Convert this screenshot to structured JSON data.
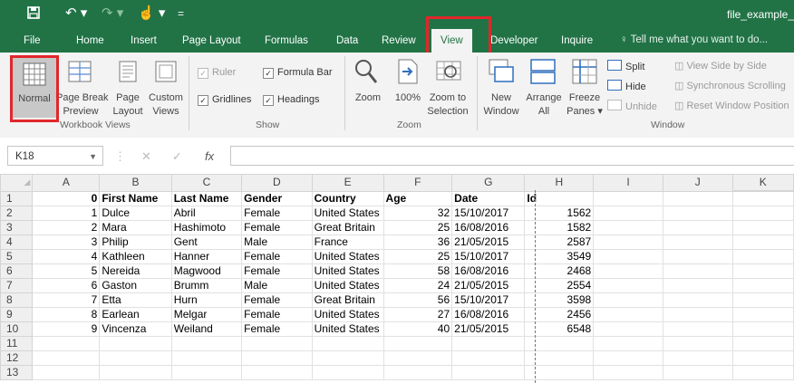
{
  "titlebar": {
    "save_icon": "save-icon",
    "undo_icon": "undo-icon",
    "redo_icon": "redo-icon",
    "touch_icon": "touch-mode-icon",
    "customize_icon": "customize-icon",
    "file_name": "file_example_"
  },
  "tabs": {
    "file": "File",
    "home": "Home",
    "insert": "Insert",
    "page_layout": "Page Layout",
    "formulas": "Formulas",
    "data": "Data",
    "review": "Review",
    "view": "View",
    "developer": "Developer",
    "inquire": "Inquire",
    "tell_me": "Tell me what you want to do..."
  },
  "ribbon": {
    "workbook_views": {
      "group_label": "Workbook Views",
      "normal": "Normal",
      "page_break_1": "Page Break",
      "page_break_2": "Preview",
      "page_layout_1": "Page",
      "page_layout_2": "Layout",
      "custom_1": "Custom",
      "custom_2": "Views"
    },
    "show": {
      "group_label": "Show",
      "ruler": "Ruler",
      "formula_bar": "Formula Bar",
      "gridlines": "Gridlines",
      "headings": "Headings"
    },
    "zoom": {
      "group_label": "Zoom",
      "zoom": "Zoom",
      "hundred": "100%",
      "selection_1": "Zoom to",
      "selection_2": "Selection"
    },
    "window": {
      "group_label": "Window",
      "new_1": "New",
      "new_2": "Window",
      "arrange_1": "Arrange",
      "arrange_2": "All",
      "freeze_1": "Freeze",
      "freeze_2": "Panes ▾",
      "split": "Split",
      "hide": "Hide",
      "unhide": "Unhide",
      "side_by_side": "View Side by Side",
      "synchronous": "Synchronous Scrolling",
      "reset": "Reset Window Position"
    }
  },
  "formula_bar": {
    "name_box": "K18",
    "cancel": "✕",
    "enter": "✓",
    "fx": "fx"
  },
  "sheet": {
    "columns": [
      "A",
      "B",
      "C",
      "D",
      "E",
      "F",
      "G",
      "H",
      "I",
      "J",
      "K"
    ],
    "header_row": [
      "0",
      "First Name",
      "Last Name",
      "Gender",
      "Country",
      "Age",
      "Date",
      "Id"
    ],
    "rows": [
      [
        "1",
        "Dulce",
        "Abril",
        "Female",
        "United States",
        "32",
        "15/10/2017",
        "1562"
      ],
      [
        "2",
        "Mara",
        "Hashimoto",
        "Female",
        "Great Britain",
        "25",
        "16/08/2016",
        "1582"
      ],
      [
        "3",
        "Philip",
        "Gent",
        "Male",
        "France",
        "36",
        "21/05/2015",
        "2587"
      ],
      [
        "4",
        "Kathleen",
        "Hanner",
        "Female",
        "United States",
        "25",
        "15/10/2017",
        "3549"
      ],
      [
        "5",
        "Nereida",
        "Magwood",
        "Female",
        "United States",
        "58",
        "16/08/2016",
        "2468"
      ],
      [
        "6",
        "Gaston",
        "Brumm",
        "Male",
        "United States",
        "24",
        "21/05/2015",
        "2554"
      ],
      [
        "7",
        "Etta",
        "Hurn",
        "Female",
        "Great Britain",
        "56",
        "15/10/2017",
        "3598"
      ],
      [
        "8",
        "Earlean",
        "Melgar",
        "Female",
        "United States",
        "27",
        "16/08/2016",
        "2456"
      ],
      [
        "9",
        "Vincenza",
        "Weiland",
        "Female",
        "United States",
        "40",
        "21/05/2015",
        "6548"
      ]
    ],
    "row_numbers": [
      "1",
      "2",
      "3",
      "4",
      "5",
      "6",
      "7",
      "8",
      "9",
      "10",
      "11",
      "12",
      "13"
    ]
  }
}
